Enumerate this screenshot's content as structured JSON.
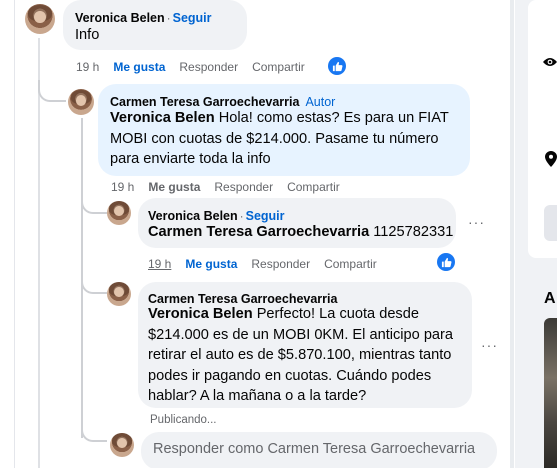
{
  "comments": [
    {
      "author": "Veronica Belen",
      "follow_label": "Seguir",
      "text": "Info",
      "time": "19 h",
      "like_label": "Me gusta",
      "reply_label": "Responder",
      "share_label": "Compartir"
    },
    {
      "author": "Carmen Teresa Garroechevarria",
      "author_badge": "Autor",
      "mention": "Veronica Belen",
      "text": "Hola! como estas? Es para un FIAT MOBI con cuotas de $214.000. Pasame tu número para enviarte toda la info",
      "time": "19 h",
      "like_label": "Me gusta",
      "reply_label": "Responder",
      "share_label": "Compartir"
    },
    {
      "author": "Veronica Belen",
      "follow_label": "Seguir",
      "mention": "Carmen Teresa Garroechevarria",
      "text": "1125782331",
      "time": "19 h",
      "like_label": "Me gusta",
      "reply_label": "Responder",
      "share_label": "Compartir"
    },
    {
      "author": "Carmen Teresa Garroechevarria",
      "mention": "Veronica Belen",
      "text": "Perfecto! La cuota desde $214.000 es de un MOBI 0KM. El anticipo para retirar el auto es de $5.870.100, mientras tanto podes ir pagando en cuotas. Cuándo podes hablar? A la mañana o a la tarde?",
      "status": "Publicando..."
    }
  ],
  "reply_box": {
    "placeholder": "Responder como Carmen Teresa Garroechevarria"
  },
  "right_panel": {
    "heading_fragment": "A"
  },
  "icons": [
    "like-reaction-icon",
    "more-options-icon",
    "eye-icon",
    "location-pin-icon"
  ]
}
